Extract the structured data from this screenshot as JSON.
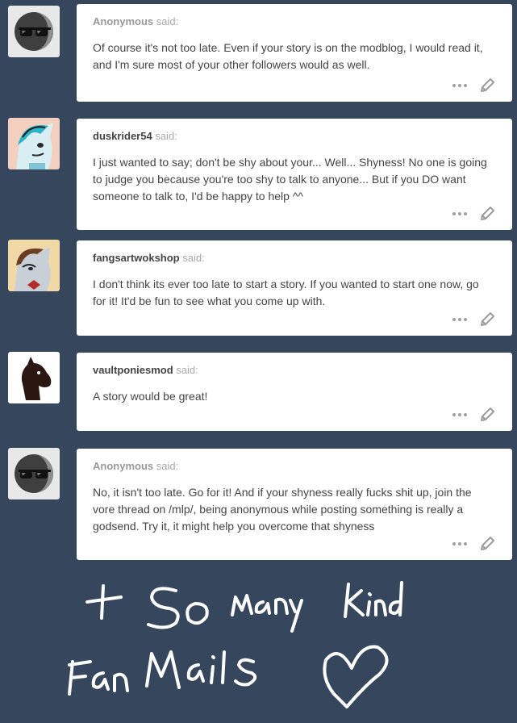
{
  "posts": [
    {
      "asker": "Anonymous",
      "said": "said:",
      "anon": true,
      "message": "Of course it's not too late. Even if your story is on the modblog, I would read it, and I'm sure most of your other followers would as well."
    },
    {
      "asker": "duskrider54",
      "said": "said:",
      "anon": false,
      "message": "I just wanted to say; don't be shy about your... Well... Shyness! No one is going to judge you because you're too shy to talk to anyone... But if you DO want someone to talk to, I'd be happy to help ^^"
    },
    {
      "asker": "fangsartwokshop",
      "said": "said:",
      "anon": false,
      "message": "I don't think its ever too late to start a story. If you wanted to start one now, go for it! It'd be fun to see what you come up with."
    },
    {
      "asker": "vaultponiesmod",
      "said": "said:",
      "anon": false,
      "message": "A story would be great!"
    },
    {
      "asker": "Anonymous",
      "said": "said:",
      "anon": true,
      "message": "No, it isn't too late. Go for it! And if your shyness really fucks shit up, join the vore thread on /mlp/, being anonymous while posting something is really a godsend. Try it, it might help you overcome that shyness"
    }
  ],
  "handwritten_note": "+ So many kind Fan Mails ♡",
  "icons": {
    "more": "more-dots-icon",
    "edit": "pencil-icon"
  },
  "colors": {
    "background": "#36465d",
    "card": "#ffffff",
    "text": "#444444",
    "muted": "#999999"
  }
}
